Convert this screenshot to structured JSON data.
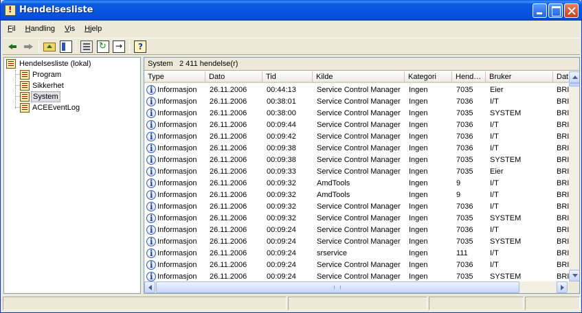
{
  "window": {
    "title": "Hendelsesliste"
  },
  "menu": [
    {
      "label": "Fil",
      "accel": "F",
      "rest": "il"
    },
    {
      "label": "Handling",
      "accel": "H",
      "rest": "andling"
    },
    {
      "label": "Vis",
      "accel": "V",
      "rest": "is"
    },
    {
      "label": "Hjelp",
      "accel": "H",
      "rest": "jelp"
    }
  ],
  "toolbar": {
    "icons": [
      "back-arrow-icon",
      "forward-arrow-icon",
      "up-folder-icon",
      "show-hide-tree-icon",
      "properties-icon",
      "refresh-icon",
      "export-list-icon",
      "help-icon"
    ]
  },
  "tree": {
    "root": "Hendelsesliste (lokal)",
    "children": [
      "Program",
      "Sikkerhet",
      "System",
      "ACEEventLog"
    ],
    "selected": "System"
  },
  "pane_header": {
    "name": "System",
    "count": "2 411 hendelse(r)"
  },
  "columns": [
    "Type",
    "Dato",
    "Tid",
    "Kilde",
    "Kategori",
    "Hend…",
    "Bruker",
    "Dat"
  ],
  "rows": [
    {
      "type": "Informasjon",
      "date": "26.11.2006",
      "time": "00:44:13",
      "source": "Service Control Manager",
      "category": "Ingen",
      "event": "7035",
      "user": "Eier",
      "computer": "BRI"
    },
    {
      "type": "Informasjon",
      "date": "26.11.2006",
      "time": "00:38:01",
      "source": "Service Control Manager",
      "category": "Ingen",
      "event": "7036",
      "user": "I/T",
      "computer": "BRI"
    },
    {
      "type": "Informasjon",
      "date": "26.11.2006",
      "time": "00:38:00",
      "source": "Service Control Manager",
      "category": "Ingen",
      "event": "7035",
      "user": "SYSTEM",
      "computer": "BRI"
    },
    {
      "type": "Informasjon",
      "date": "26.11.2006",
      "time": "00:09:44",
      "source": "Service Control Manager",
      "category": "Ingen",
      "event": "7036",
      "user": "I/T",
      "computer": "BRI"
    },
    {
      "type": "Informasjon",
      "date": "26.11.2006",
      "time": "00:09:42",
      "source": "Service Control Manager",
      "category": "Ingen",
      "event": "7036",
      "user": "I/T",
      "computer": "BRI"
    },
    {
      "type": "Informasjon",
      "date": "26.11.2006",
      "time": "00:09:38",
      "source": "Service Control Manager",
      "category": "Ingen",
      "event": "7036",
      "user": "I/T",
      "computer": "BRI"
    },
    {
      "type": "Informasjon",
      "date": "26.11.2006",
      "time": "00:09:38",
      "source": "Service Control Manager",
      "category": "Ingen",
      "event": "7035",
      "user": "SYSTEM",
      "computer": "BRI"
    },
    {
      "type": "Informasjon",
      "date": "26.11.2006",
      "time": "00:09:33",
      "source": "Service Control Manager",
      "category": "Ingen",
      "event": "7035",
      "user": "Eier",
      "computer": "BRI"
    },
    {
      "type": "Informasjon",
      "date": "26.11.2006",
      "time": "00:09:32",
      "source": "AmdTools",
      "category": "Ingen",
      "event": "9",
      "user": "I/T",
      "computer": "BRI"
    },
    {
      "type": "Informasjon",
      "date": "26.11.2006",
      "time": "00:09:32",
      "source": "AmdTools",
      "category": "Ingen",
      "event": "9",
      "user": "I/T",
      "computer": "BRI"
    },
    {
      "type": "Informasjon",
      "date": "26.11.2006",
      "time": "00:09:32",
      "source": "Service Control Manager",
      "category": "Ingen",
      "event": "7036",
      "user": "I/T",
      "computer": "BRI"
    },
    {
      "type": "Informasjon",
      "date": "26.11.2006",
      "time": "00:09:32",
      "source": "Service Control Manager",
      "category": "Ingen",
      "event": "7035",
      "user": "SYSTEM",
      "computer": "BRI"
    },
    {
      "type": "Informasjon",
      "date": "26.11.2006",
      "time": "00:09:24",
      "source": "Service Control Manager",
      "category": "Ingen",
      "event": "7036",
      "user": "I/T",
      "computer": "BRI"
    },
    {
      "type": "Informasjon",
      "date": "26.11.2006",
      "time": "00:09:24",
      "source": "Service Control Manager",
      "category": "Ingen",
      "event": "7035",
      "user": "SYSTEM",
      "computer": "BRI"
    },
    {
      "type": "Informasjon",
      "date": "26.11.2006",
      "time": "00:09:24",
      "source": "srservice",
      "category": "Ingen",
      "event": "111",
      "user": "I/T",
      "computer": "BRI"
    },
    {
      "type": "Informasjon",
      "date": "26.11.2006",
      "time": "00:09:24",
      "source": "Service Control Manager",
      "category": "Ingen",
      "event": "7036",
      "user": "I/T",
      "computer": "BRI"
    },
    {
      "type": "Informasjon",
      "date": "26.11.2006",
      "time": "00:09:24",
      "source": "Service Control Manager",
      "category": "Ingen",
      "event": "7035",
      "user": "SYSTEM",
      "computer": "BRI"
    }
  ]
}
